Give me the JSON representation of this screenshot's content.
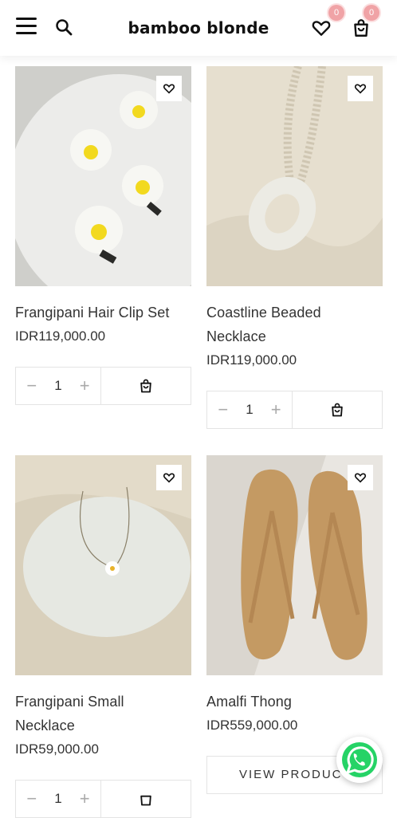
{
  "header": {
    "brand": "bamboo blonde",
    "wishlist_count": "0",
    "cart_count": "0",
    "icons": [
      "menu-icon",
      "search-icon",
      "heart-icon",
      "shopping-bag-icon"
    ]
  },
  "products": [
    {
      "name": "Frangipani Hair Clip Set",
      "price": "IDR119,000.00",
      "qty": "1",
      "action": "add-to-cart-icon"
    },
    {
      "name": "Coastline Beaded Necklace",
      "price": "IDR119,000.00",
      "qty": "1",
      "action": "add-to-cart-icon"
    },
    {
      "name": "Frangipani Small Necklace",
      "price": "IDR59,000.00",
      "qty": "1",
      "action": "add-to-cart-icon"
    },
    {
      "name": "Amalfi Thong",
      "price": "IDR559,000.00",
      "action_label": "VIEW PRODUCT"
    }
  ],
  "colors": {
    "badge": "#f0a3a6",
    "whatsapp": "#25d366"
  }
}
